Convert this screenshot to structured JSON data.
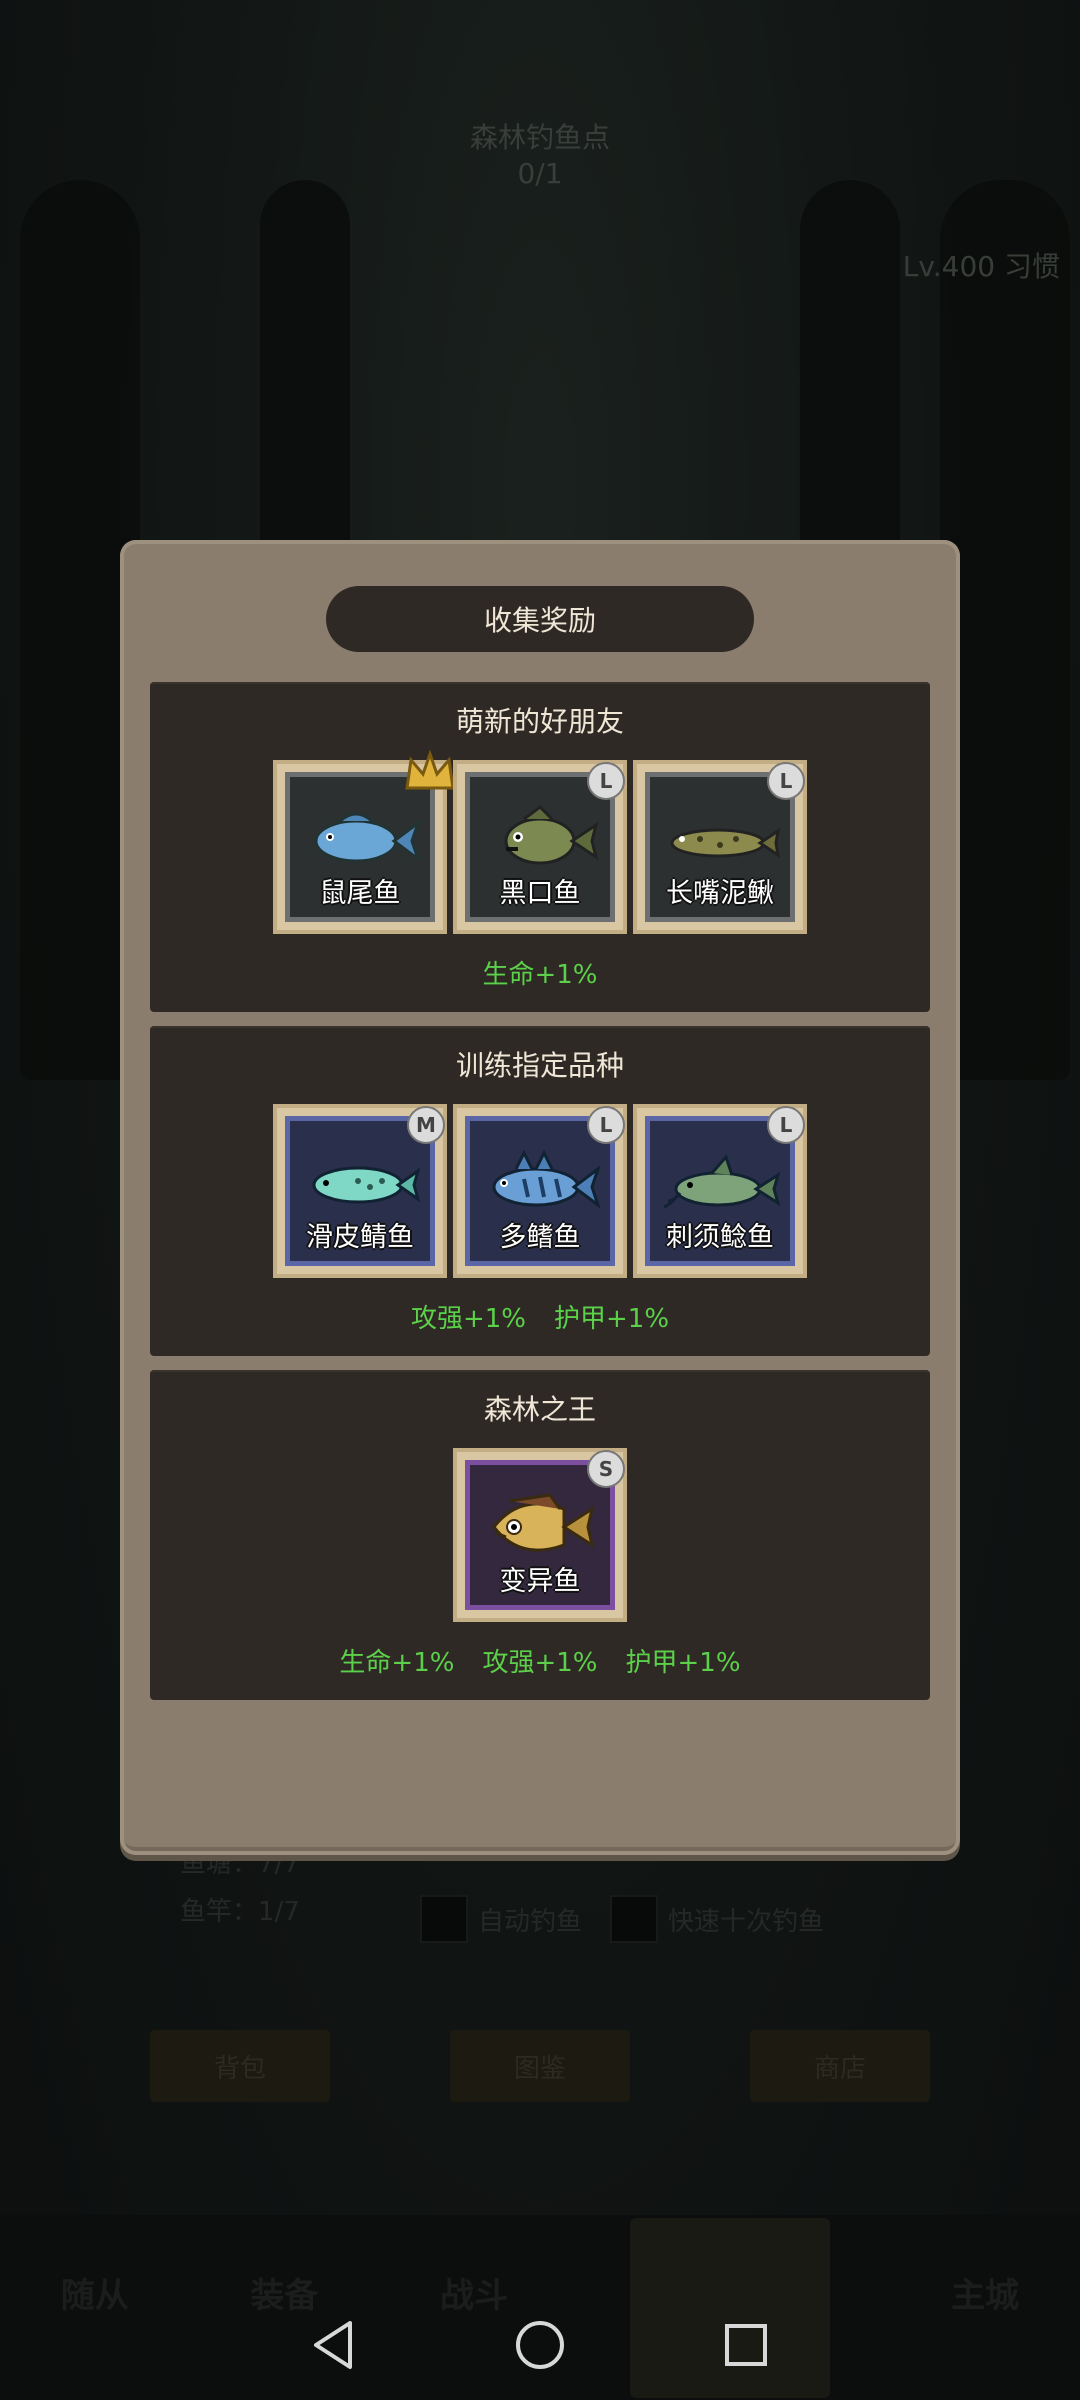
{
  "background": {
    "title": "森林钓鱼点",
    "progress": "0/1",
    "level_text": "Lv.400 习惯",
    "stats": [
      "鱼塘：7/7",
      "鱼竿：1/7"
    ],
    "toggles": [
      "自动钓鱼",
      "快速十次钓鱼"
    ],
    "buttons": [
      "背包",
      "图鉴",
      "商店"
    ],
    "nav": [
      "随从",
      "装备",
      "战斗",
      "主城"
    ]
  },
  "modal": {
    "title": "收集奖励",
    "sections": [
      {
        "title": "萌新的好朋友",
        "fishes": [
          {
            "name": "鼠尾鱼",
            "badge": "crown",
            "fish_color": "#6aa6d6"
          },
          {
            "name": "黑口鱼",
            "badge": "L",
            "fish_color": "#7c8a52"
          },
          {
            "name": "长嘴泥鳅",
            "badge": "L",
            "fish_color": "#8c8a4c"
          }
        ],
        "bonuses": [
          "生命+1%"
        ]
      },
      {
        "title": "训练指定品种",
        "fishes": [
          {
            "name": "滑皮鲭鱼",
            "badge": "M",
            "fish_color": "#7fd8c6"
          },
          {
            "name": "多鳍鱼",
            "badge": "L",
            "fish_color": "#6a9fd6"
          },
          {
            "name": "刺须鲶鱼",
            "badge": "L",
            "fish_color": "#7ea37a"
          }
        ],
        "bonuses": [
          "攻强+1%",
          "护甲+1%"
        ]
      },
      {
        "title": "森林之王",
        "fishes": [
          {
            "name": "变异鱼",
            "badge": "S",
            "fish_color": "#d9b35a"
          }
        ],
        "bonuses": [
          "生命+1%",
          "攻强+1%",
          "护甲+1%"
        ]
      }
    ]
  },
  "colors": {
    "bonus": "#5bd14a",
    "panel": "#8a7d6e",
    "section_bg": "#2f2925",
    "grey_frame": "#6d6f70",
    "blue_frame": "#5a66a6",
    "purple_frame": "#7d4fa1"
  },
  "icons": [
    "back-icon",
    "home-icon",
    "recents-icon",
    "crown-icon"
  ]
}
